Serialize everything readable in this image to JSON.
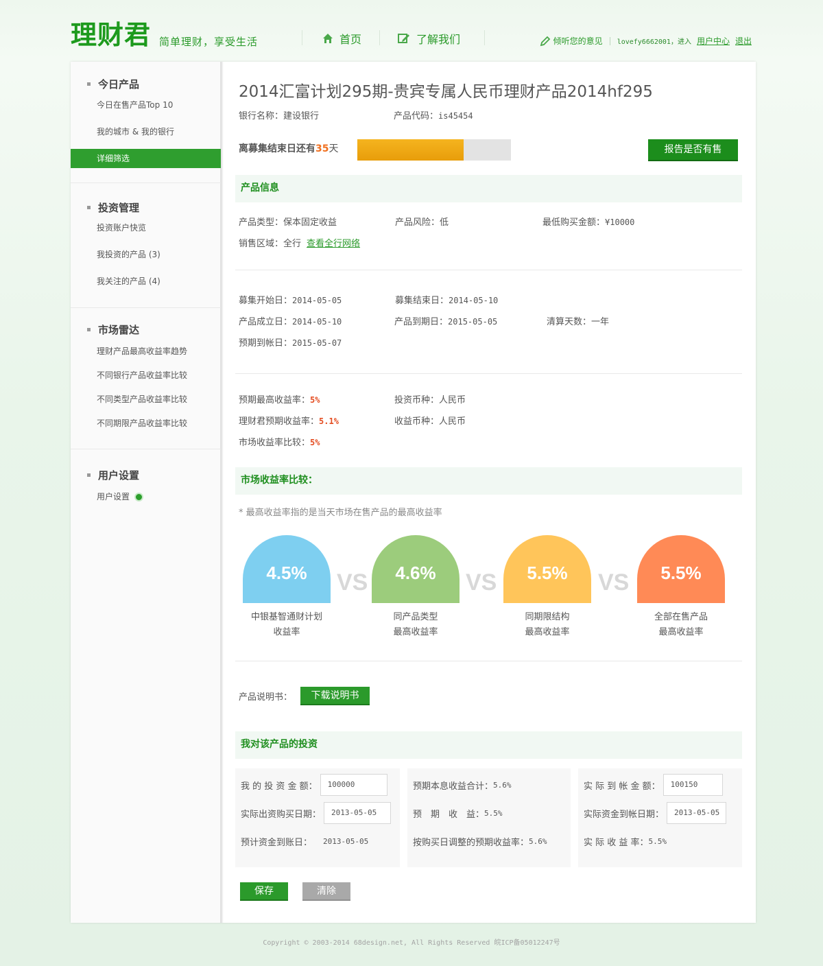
{
  "header": {
    "logo": "理财君",
    "slogan": "简单理财，享受生活",
    "nav_home": "首页",
    "nav_about": "了解我们",
    "feedback": "倾听您的意见",
    "username": "lovefy6662001，进入",
    "user_center": "用户中心",
    "logout": "退出"
  },
  "sidebar": {
    "groups": [
      {
        "title": "今日产品",
        "items": [
          "今日在售产品Top 10",
          "我的城市 & 我的银行",
          "详细筛选"
        ]
      },
      {
        "title": "投资管理",
        "items": [
          "投资账户快览",
          "我投资的产品 (3)",
          "我关注的产品 (4)"
        ]
      },
      {
        "title": "市场雷达",
        "items": [
          "理财产品最高收益率趋势",
          "不同银行产品收益率比较",
          "不同类型产品收益率比较",
          "不同期限产品收益率比较"
        ]
      },
      {
        "title": "用户设置",
        "items": [
          "用户设置"
        ]
      }
    ],
    "active_item": "详细筛选"
  },
  "product": {
    "title": "2014汇富计划295期-贵宾专属人民币理财产品2014hf295",
    "bank_label": "银行名称：",
    "bank": "建设银行",
    "code_label": "产品代码：",
    "code": "is45454",
    "countdown_prefix": "离募集结束日还有",
    "countdown_days": "35",
    "countdown_suffix": "天",
    "progress_fraction": 0.69,
    "report_button": "报告是否有售"
  },
  "info": {
    "section_title": "产品信息",
    "type_label": "产品类型：",
    "type": "保本固定收益",
    "risk_label": "产品风险：",
    "risk": "低",
    "min_label": "最低购买金额：",
    "min": "¥10000",
    "region_label": "销售区域：",
    "region": "全行",
    "region_link": "查看全行网络",
    "raise_start_label": "募集开始日：",
    "raise_start": "2014-05-05",
    "raise_end_label": "募集结束日：",
    "raise_end": "2014-05-10",
    "est_label": "产品成立日：",
    "est": "2014-05-10",
    "mature_label": "产品到期日：",
    "mature": "2015-05-05",
    "clear_label": "清算天数：",
    "clear": "一年",
    "arrive_label": "预期到帐日：",
    "arrive": "2015-05-07",
    "max_yield_label": "预期最高收益率：",
    "max_yield": "5%",
    "currency_label": "投资币种：",
    "currency": "人民币",
    "ours_yield_label": "理财君预期收益率：",
    "ours_yield": "5.1%",
    "income_currency_label": "收益币种：",
    "income_currency": "人民币",
    "market_label": "市场收益率比较：",
    "market": "5%"
  },
  "market": {
    "section_title": "市场收益率比较：",
    "note": "* 最高收益率指的是当天市场在售产品的最高收益率",
    "vs": "VS",
    "items": [
      {
        "value": "4.5%",
        "line1": "中银基智通财计划",
        "line2": "收益率",
        "color": "#7ecff0"
      },
      {
        "value": "4.6%",
        "line1": "同产品类型",
        "line2": "最高收益率",
        "color": "#9ccc7c"
      },
      {
        "value": "5.5%",
        "line1": "同期限结构",
        "line2": "最高收益率",
        "color": "#ffc55a"
      },
      {
        "value": "5.5%",
        "line1": "全部在售产品",
        "line2": "最高收益率",
        "color": "#ff8a56"
      }
    ]
  },
  "manual": {
    "label": "产品说明书：",
    "button": "下载说明书"
  },
  "investment": {
    "section_title": "我对该产品的投资",
    "amount_label": "我 的 投 资 金 额：",
    "amount": "100000",
    "buy_date_label": "实际出资购买日期：",
    "buy_date": "2013-05-05",
    "est_arrive_label": "预计资金到账日：",
    "est_arrive": "2013-05-05",
    "total_label": "预期本息收益合计：",
    "total": "5.6%",
    "expected_label": "预　期　收　益：",
    "expected": "5.5%",
    "adjusted_label": "按购买日调整的预期收益率：",
    "adjusted": "5.6%",
    "actual_amount_label": "实 际 到 帐 金 额：",
    "actual_amount": "100150",
    "actual_date_label": "实际资金到帐日期：",
    "actual_date": "2013-05-05",
    "actual_rate_label": "实 际 收 益 率：",
    "actual_rate": "5.5%",
    "save": "保存",
    "clear": "清除"
  },
  "footer": "Copyright © 2003-2014 68design.net, All Rights Reserved  皖ICP备05012247号",
  "colors": {
    "brand_green": "#1d9a1d",
    "accent_orange": "#f07020",
    "button_gray": "#a9a9a9"
  }
}
